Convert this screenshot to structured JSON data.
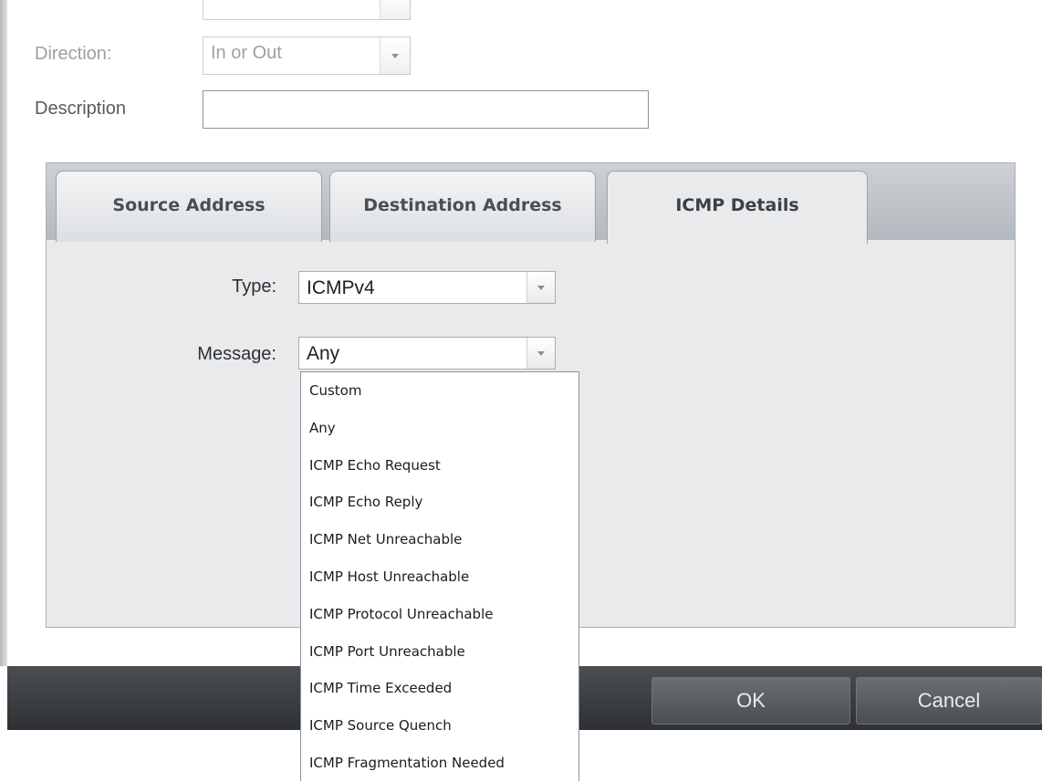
{
  "form": {
    "direction_label": "Direction:",
    "direction_value": "In or Out",
    "description_label": "Description",
    "description_value": ""
  },
  "tabs": [
    {
      "label": "Source Address",
      "active": false
    },
    {
      "label": "Destination Address",
      "active": false
    },
    {
      "label": "ICMP Details",
      "active": true
    }
  ],
  "icmp": {
    "type_label": "Type:",
    "type_value": "ICMPv4",
    "message_label": "Message:",
    "message_value": "Any"
  },
  "message_options": [
    "Custom",
    "Any",
    "ICMP Echo Request",
    "ICMP Echo Reply",
    "ICMP Net Unreachable",
    "ICMP Host Unreachable",
    "ICMP Protocol Unreachable",
    "ICMP Port Unreachable",
    "ICMP Time Exceeded",
    "ICMP Source Quench",
    "ICMP Fragmentation Needed"
  ],
  "buttons": {
    "ok": "OK",
    "cancel": "Cancel"
  },
  "icons": {
    "dropdown_arrow": "chevron-down-icon"
  }
}
